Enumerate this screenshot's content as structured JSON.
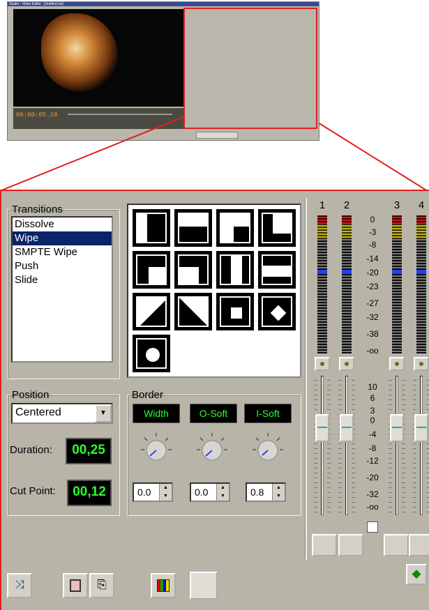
{
  "thumbnail": {
    "title": "Studio - Video Editor - [Untitled.stx]",
    "timecode": "00:00:05.18"
  },
  "transitions": {
    "legend": "Transitions",
    "items": [
      "Dissolve",
      "Wipe",
      "SMPTE Wipe",
      "Push",
      "Slide"
    ],
    "selected": "Wipe"
  },
  "position": {
    "legend": "Position",
    "mode": "Centered",
    "duration_label": "Duration:",
    "duration": "00,25",
    "cutpoint_label": "Cut Point:",
    "cutpoint": "00,12"
  },
  "border": {
    "legend": "Border",
    "width_label": "Width",
    "osoft_label": "O-Soft",
    "isoft_label": "I-Soft",
    "width": "0.0",
    "osoft": "0.0",
    "isoft": "0.8"
  },
  "mixer": {
    "channels": [
      "1",
      "2",
      "3",
      "4"
    ],
    "meter_scale": [
      "0",
      "-3",
      "-8",
      "-14",
      "-20",
      "-23",
      "-27",
      "-32",
      "-38",
      "-oo"
    ],
    "fader_scale": [
      "10",
      "6",
      "3",
      "0",
      "-4",
      "-8",
      "-12",
      "-20",
      "-32",
      "-oo"
    ]
  },
  "icons": [
    "swap-icon",
    "clip-icon",
    "snapshot-icon",
    "palette-icon",
    "expand-icon"
  ]
}
